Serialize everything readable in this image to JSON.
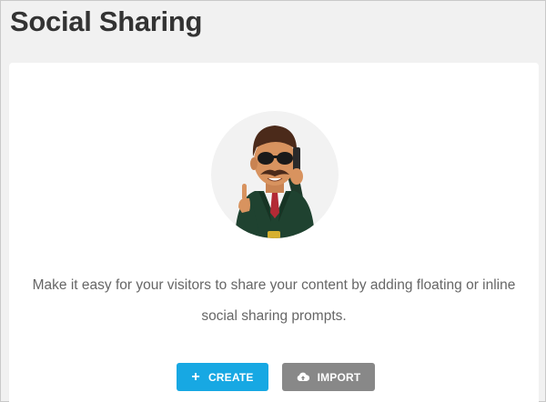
{
  "page": {
    "title": "Social Sharing"
  },
  "empty_state": {
    "description": "Make it easy for your visitors to share your content by adding floating or inline social sharing prompts.",
    "illustration": "agent-character-illustration"
  },
  "actions": {
    "create_label": "CREATE",
    "create_icon": "plus-icon",
    "import_label": "IMPORT",
    "import_icon": "cloud-upload-icon"
  },
  "colors": {
    "create_button": "#17a8e3",
    "import_button": "#888888",
    "title": "#333333",
    "text": "#666666",
    "background": "#f1f1f1"
  }
}
